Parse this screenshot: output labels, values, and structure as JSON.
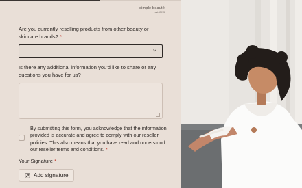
{
  "brand": {
    "name": "simple beauté",
    "est": "est. 2013"
  },
  "progress": {
    "fraction": 0.55
  },
  "questions": {
    "reselling": {
      "text": "Are you currently reselling products from other beauty or skincare brands?",
      "required_mark": "*",
      "selected_value": ""
    },
    "additional_info": {
      "text": "Is there any additional information you'd like to share or any questions you have for us?",
      "value": ""
    }
  },
  "consent": {
    "text": "By submitting this form, you acknowledge that the information provided is accurate and agree to comply with our reseller policies. This also means that you have read and understood our reseller terms and conditions.",
    "required_mark": "*",
    "checked": false
  },
  "signature": {
    "label": "Your Signature",
    "required_mark": "*",
    "button_label": "Add signature"
  },
  "icons": {
    "select_chevron": "chevron-down-icon",
    "signature": "pen-icon"
  },
  "colors": {
    "panel_bg": "#e9dfd7",
    "text": "#2f2a27",
    "required": "#c0392b"
  }
}
